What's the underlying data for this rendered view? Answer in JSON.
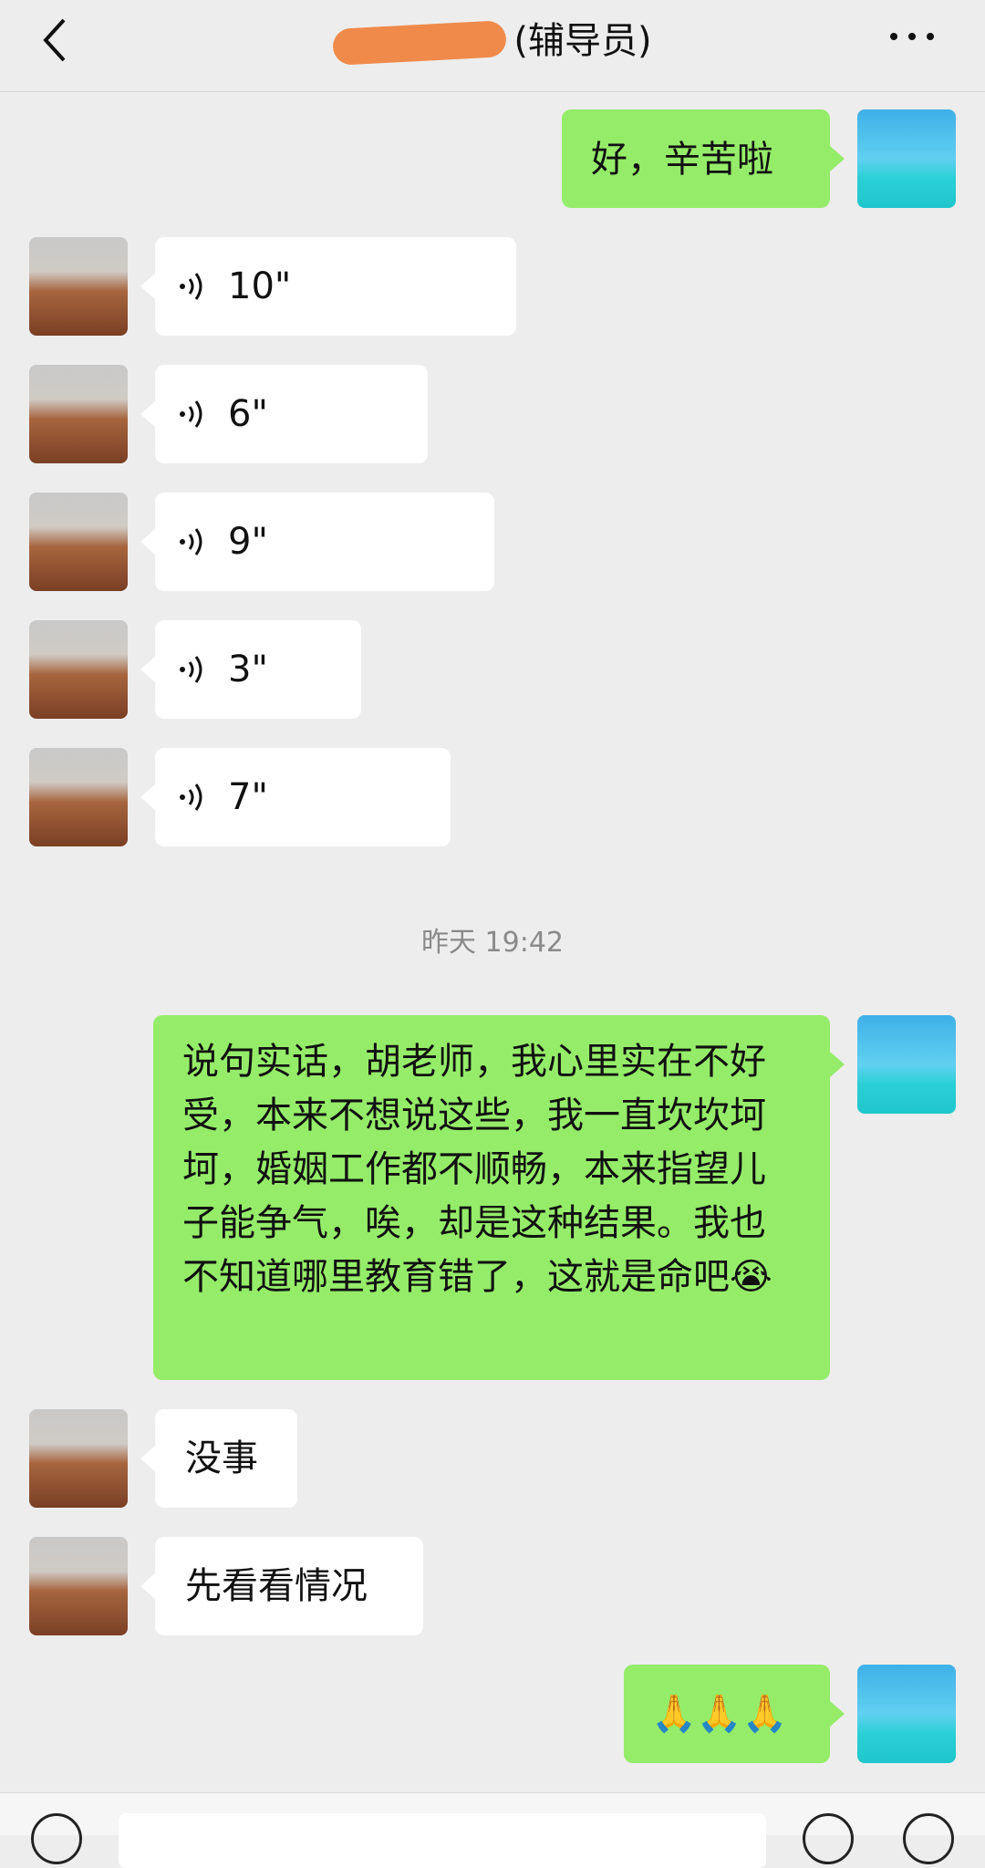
{
  "header": {
    "title_suffix": "(辅导员)"
  },
  "messages": {
    "m1": {
      "text": "好，辛苦啦"
    },
    "v1": {
      "duration": "10\""
    },
    "v2": {
      "duration": "6\""
    },
    "v3": {
      "duration": "9\""
    },
    "v4": {
      "duration": "3\""
    },
    "v5": {
      "duration": "7\""
    },
    "timestamp": "昨天 19:42",
    "m2": {
      "text": "说句实话，胡老师，我心里实在不好受，本来不想说这些，我一直坎坎坷坷，婚姻工作都不顺畅，本来指望儿子能争气，唉，却是这种结果。我也不知道哪里教育错了，这就是命吧😭"
    },
    "m3": {
      "text": "没事"
    },
    "m4": {
      "text": "先看看情况"
    },
    "m5": {
      "text": "🙏🙏🙏"
    }
  },
  "icons": {
    "back": "chevron-left-icon",
    "more": "more-dots-icon",
    "voice": "voice-wave-icon"
  },
  "colors": {
    "background": "#ededed",
    "sent_bubble": "#95ec69",
    "received_bubble": "#ffffff",
    "redaction": "#f08a4b"
  }
}
